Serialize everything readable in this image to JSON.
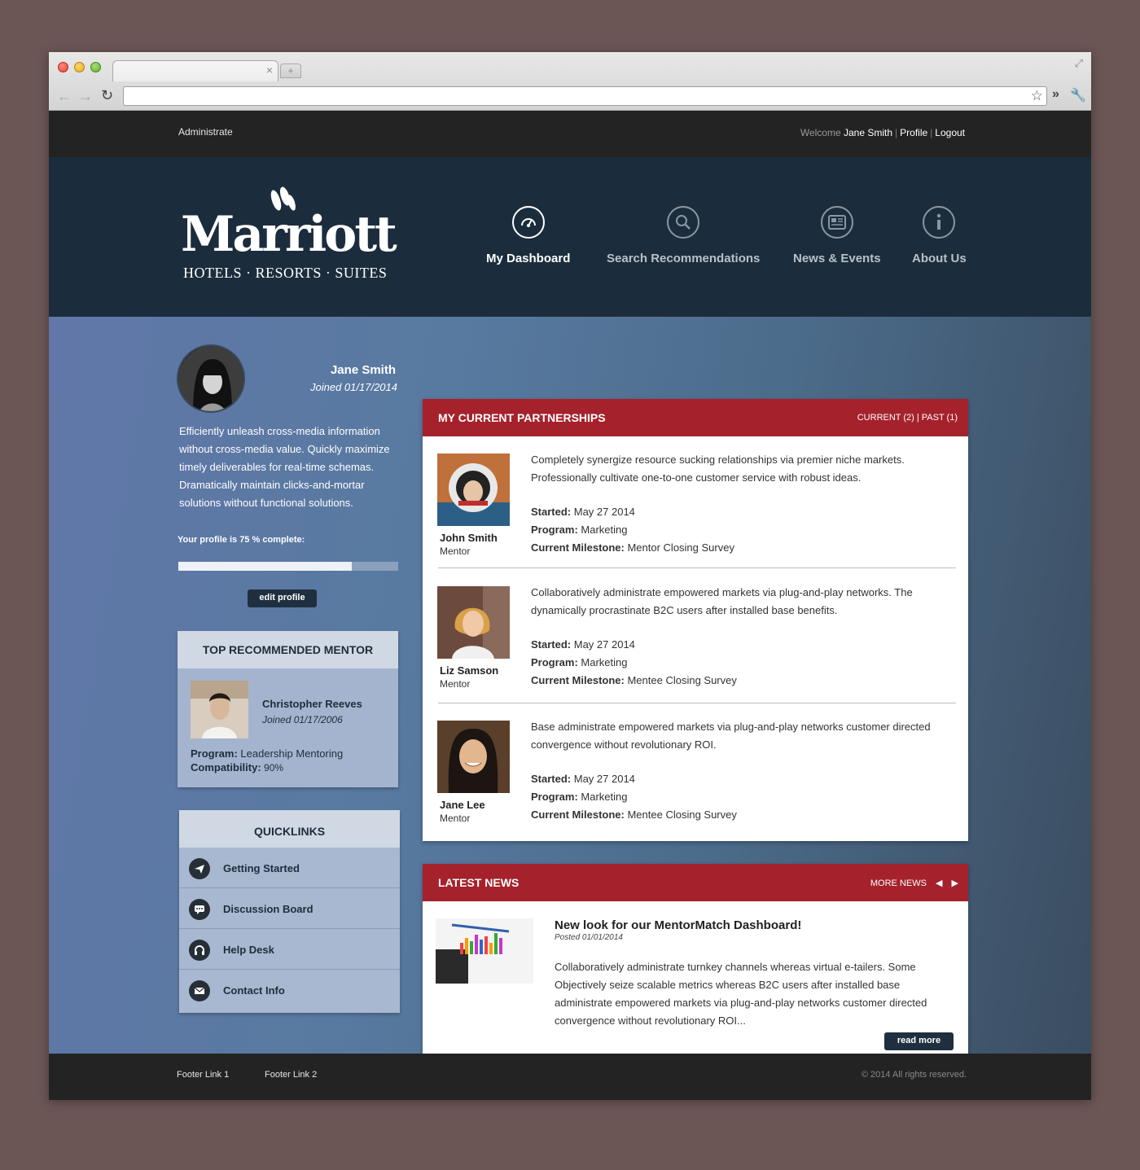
{
  "browser": {
    "tab_close": "×",
    "new_tab": "+"
  },
  "topbar": {
    "admin_label": "Administrate",
    "welcome_text": "Welcome",
    "user_name": "Jane Smith",
    "profile_link": "Profile",
    "logout_link": "Logout"
  },
  "brand": {
    "wordmark": "Marriott",
    "tagline": "HOTELS · RESORTS · SUITES"
  },
  "nav": [
    {
      "label": "My Dashboard",
      "icon": "dashboard-icon",
      "active": true
    },
    {
      "label": "Search Recommendations",
      "icon": "search-icon",
      "active": false
    },
    {
      "label": "News & Events",
      "icon": "news-icon",
      "active": false
    },
    {
      "label": "About Us",
      "icon": "info-icon",
      "active": false
    }
  ],
  "profile": {
    "name": "Jane Smith",
    "joined": "Joined 01/17/2014",
    "bio": "Efficiently unleash cross-media information without cross-media value. Quickly maximize timely deliverables for real-time schemas. Dramatically maintain clicks-and-mortar solutions without functional solutions.",
    "complete_text": "Your profile is 75 % complete:",
    "complete_fraction": 0.79,
    "edit_label": "edit profile"
  },
  "recommended_mentor": {
    "heading": "TOP RECOMMENDED MENTOR",
    "name": "Christopher Reeves",
    "joined": "Joined 01/17/2006",
    "program_label": "Program:",
    "program": "Leadership Mentoring",
    "compat_label": "Compatibility:",
    "compat": "90%"
  },
  "quicklinks": {
    "heading": "QUICKLINKS",
    "items": [
      {
        "label": "Getting Started",
        "icon": "paper-plane-icon"
      },
      {
        "label": "Discussion Board",
        "icon": "chat-icon"
      },
      {
        "label": "Help Desk",
        "icon": "headset-icon"
      },
      {
        "label": "Contact Info",
        "icon": "envelope-icon"
      }
    ]
  },
  "partnerships": {
    "heading": "MY CURRENT PARTNERSHIPS",
    "filter": "CURRENT (2) | PAST (1)",
    "started_label": "Started:",
    "program_label": "Program:",
    "milestone_label": "Current Milestone:",
    "items": [
      {
        "name": "John Smith",
        "role": "Mentor",
        "desc": "Completely synergize resource sucking relationships via premier niche markets. Professionally cultivate one-to-one customer service with robust ideas.",
        "started": "May 27 2014",
        "program": "Marketing",
        "milestone": "Mentor Closing Survey"
      },
      {
        "name": "Liz Samson",
        "role": "Mentor",
        "desc": "Collaboratively administrate empowered markets via plug-and-play networks. The dynamically procrastinate B2C users after installed base benefits.",
        "started": "May 27 2014",
        "program": "Marketing",
        "milestone": "Mentee Closing Survey"
      },
      {
        "name": "Jane Lee",
        "role": "Mentor",
        "desc": "Base administrate empowered markets via plug-and-play networks  customer directed convergence without revolutionary ROI.",
        "started": "May 27 2014",
        "program": "Marketing",
        "milestone": "Mentee Closing Survey"
      }
    ]
  },
  "news": {
    "heading": "LATEST NEWS",
    "more_label": "MORE NEWS",
    "title": "New look for our MentorMatch Dashboard!",
    "date": "Posted 01/01/2014",
    "body": "Collaboratively administrate turnkey channels whereas virtual e-tailers. Some Objectively seize scalable metrics whereas B2C users after installed base administrate empowered markets via plug-and-play networks  customer directed convergence without revolutionary ROI...",
    "read_more": "read more"
  },
  "footer": {
    "link1": "Footer Link 1",
    "link2": "Footer Link 2",
    "copyright": "© 2014 All rights reserved."
  }
}
